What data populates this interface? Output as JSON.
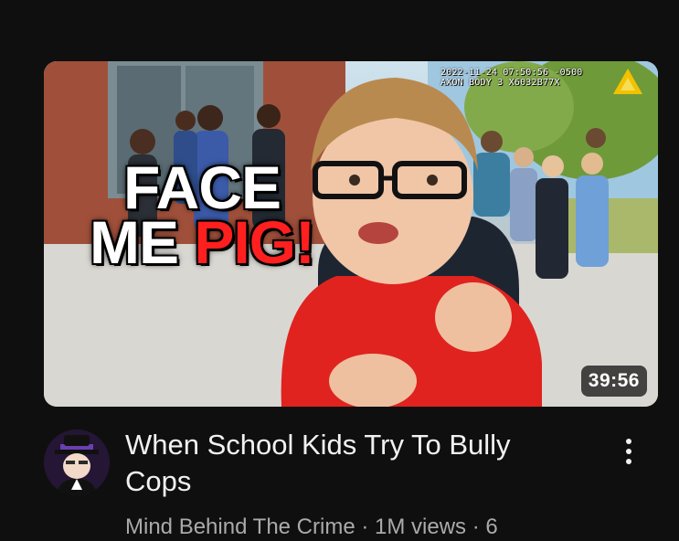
{
  "video": {
    "thumbnail": {
      "overlay_line1": "FACE",
      "overlay_line2a": "ME",
      "overlay_line2b": "PIG!",
      "bodycam_line1": "2022-11-24 07:50:56 -0500",
      "bodycam_line2": "AXON BODY 3 X6032B77X",
      "duration": "39:56",
      "accent_red": "#ff1f1f"
    },
    "title": "When School Kids Try To Bully Cops",
    "channel": "Mind Behind The Crime",
    "views": "1M views",
    "age": "6",
    "separator": " · ",
    "avatar_icon": "channel-avatar-icon",
    "menu_icon": "more-vert-icon"
  }
}
